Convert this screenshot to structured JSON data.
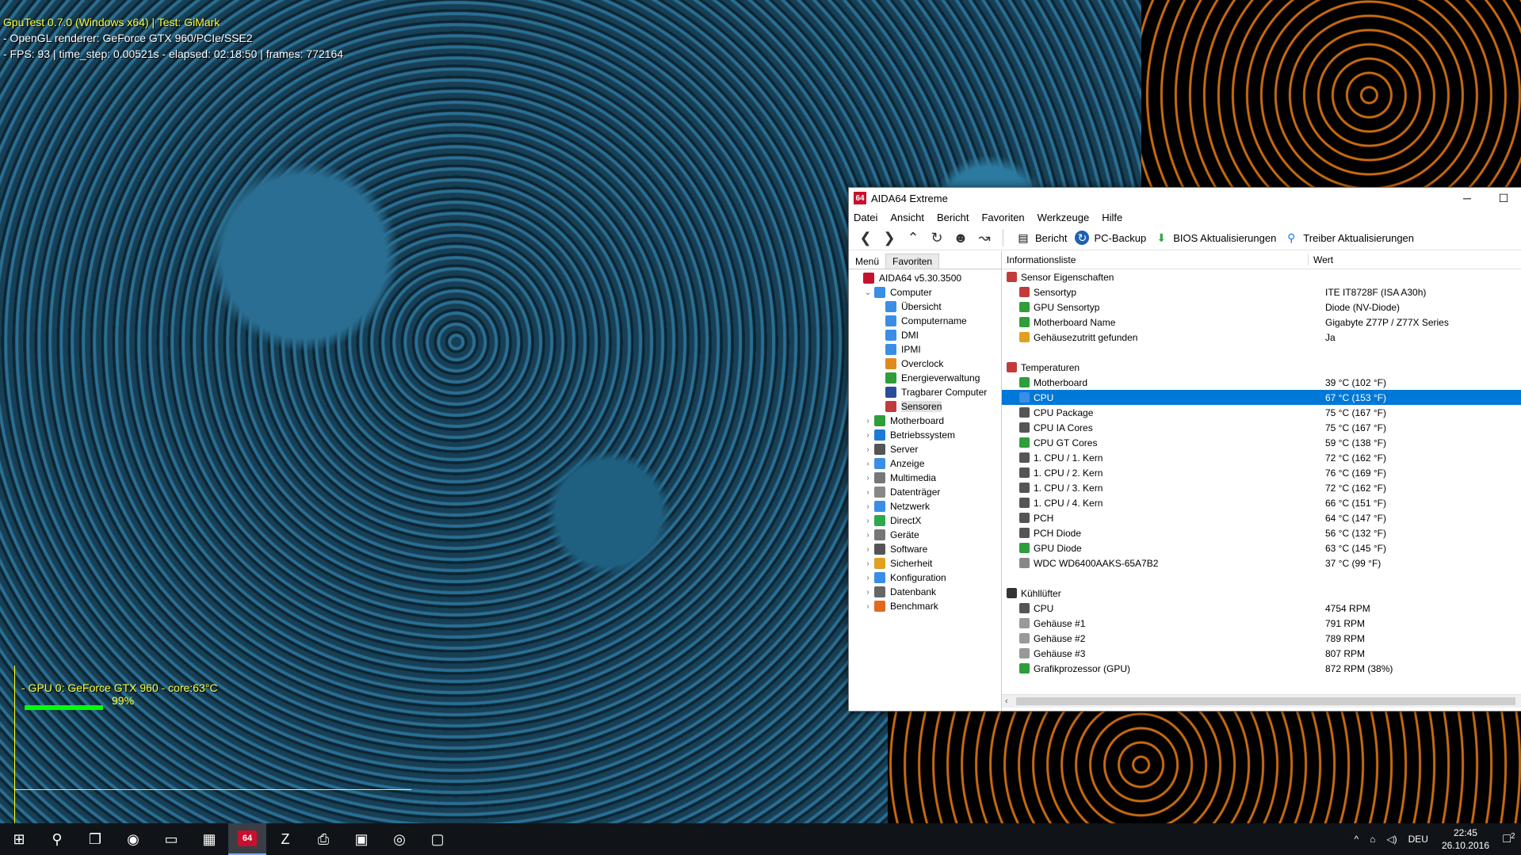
{
  "overlay": {
    "gputest_line1": "GpuTest 0.7.0 (Windows x64) | Test: GiMark",
    "gputest_line2": "- OpenGL renderer: GeForce GTX 960/PCIe/SSE2",
    "gputest_line3": "- FPS: 93 | time_step: 0.00521s - elapsed: 02:18:50 | frames: 772164",
    "gpu_monitor_label": "- GPU 0: GeForce GTX 960 - core:63°C",
    "gpu_monitor_pct": "99%",
    "gpu_utilization": 0.99
  },
  "window": {
    "title": "AIDA64 Extreme",
    "app_icon_text": "64",
    "minimize": "─",
    "maximize": "☐"
  },
  "menu": [
    "Datei",
    "Ansicht",
    "Bericht",
    "Favoriten",
    "Werkzeuge",
    "Hilfe"
  ],
  "toolbar": {
    "bericht": "Bericht",
    "pc_backup": "PC-Backup",
    "bios": "BIOS Aktualisierungen",
    "treiber": "Treiber Aktualisierungen"
  },
  "left_tabs": {
    "menu": "Menü",
    "favoriten": "Favoriten"
  },
  "tree": [
    {
      "label": "AIDA64 v5.30.3500",
      "level": 0,
      "expander": "",
      "color": "#c8102e"
    },
    {
      "label": "Computer",
      "level": 1,
      "expander": "⌄",
      "color": "#3a8ee6"
    },
    {
      "label": "Übersicht",
      "level": 2,
      "expander": "",
      "color": "#3a8ee6"
    },
    {
      "label": "Computername",
      "level": 2,
      "expander": "",
      "color": "#3a8ee6"
    },
    {
      "label": "DMI",
      "level": 2,
      "expander": "",
      "color": "#3a8ee6"
    },
    {
      "label": "IPMI",
      "level": 2,
      "expander": "",
      "color": "#3a8ee6"
    },
    {
      "label": "Overclock",
      "level": 2,
      "expander": "",
      "color": "#e08a1e"
    },
    {
      "label": "Energieverwaltung",
      "level": 2,
      "expander": "",
      "color": "#2e9d3a"
    },
    {
      "label": "Tragbarer Computer",
      "level": 2,
      "expander": "",
      "color": "#2b4c9b"
    },
    {
      "label": "Sensoren",
      "level": 2,
      "expander": "",
      "color": "#c23b3b",
      "selected": true
    },
    {
      "label": "Motherboard",
      "level": 1,
      "expander": "›",
      "color": "#2e9d3a"
    },
    {
      "label": "Betriebssystem",
      "level": 1,
      "expander": "›",
      "color": "#1e7ad6"
    },
    {
      "label": "Server",
      "level": 1,
      "expander": "›",
      "color": "#555"
    },
    {
      "label": "Anzeige",
      "level": 1,
      "expander": "›",
      "color": "#3a8ee6"
    },
    {
      "label": "Multimedia",
      "level": 1,
      "expander": "›",
      "color": "#777"
    },
    {
      "label": "Datenträger",
      "level": 1,
      "expander": "›",
      "color": "#888"
    },
    {
      "label": "Netzwerk",
      "level": 1,
      "expander": "›",
      "color": "#3a8ee6"
    },
    {
      "label": "DirectX",
      "level": 1,
      "expander": "›",
      "color": "#2ea84a"
    },
    {
      "label": "Geräte",
      "level": 1,
      "expander": "›",
      "color": "#777"
    },
    {
      "label": "Software",
      "level": 1,
      "expander": "›",
      "color": "#555"
    },
    {
      "label": "Sicherheit",
      "level": 1,
      "expander": "›",
      "color": "#e0a020"
    },
    {
      "label": "Konfiguration",
      "level": 1,
      "expander": "›",
      "color": "#3a8ee6"
    },
    {
      "label": "Datenbank",
      "level": 1,
      "expander": "›",
      "color": "#666"
    },
    {
      "label": "Benchmark",
      "level": 1,
      "expander": "›",
      "color": "#e06a1e"
    }
  ],
  "list_header": {
    "col1": "Informationsliste",
    "col2": "Wert"
  },
  "list": [
    {
      "type": "sec",
      "name": "Sensor Eigenschaften",
      "value": "",
      "color": "#c23b3b"
    },
    {
      "type": "item",
      "name": "Sensortyp",
      "value": "ITE IT8728F  (ISA A30h)",
      "color": "#c23b3b"
    },
    {
      "type": "item",
      "name": "GPU Sensortyp",
      "value": "Diode  (NV-Diode)",
      "color": "#2e9d3a"
    },
    {
      "type": "item",
      "name": "Motherboard Name",
      "value": "Gigabyte Z77P / Z77X Series",
      "color": "#2e9d3a"
    },
    {
      "type": "item",
      "name": "Gehäusezutritt gefunden",
      "value": "Ja",
      "color": "#e0a020"
    },
    {
      "type": "gap"
    },
    {
      "type": "sec",
      "name": "Temperaturen",
      "value": "",
      "color": "#c23b3b"
    },
    {
      "type": "item",
      "name": "Motherboard",
      "value": "39 °C  (102 °F)",
      "color": "#2e9d3a"
    },
    {
      "type": "item",
      "name": "CPU",
      "value": "67 °C  (153 °F)",
      "color": "#3a8ee6",
      "highlight": true
    },
    {
      "type": "item",
      "name": "CPU Package",
      "value": "75 °C  (167 °F)",
      "color": "#555"
    },
    {
      "type": "item",
      "name": "CPU IA Cores",
      "value": "75 °C  (167 °F)",
      "color": "#555"
    },
    {
      "type": "item",
      "name": "CPU GT Cores",
      "value": "59 °C  (138 °F)",
      "color": "#2e9d3a"
    },
    {
      "type": "item",
      "name": "1. CPU / 1. Kern",
      "value": "72 °C  (162 °F)",
      "color": "#555"
    },
    {
      "type": "item",
      "name": "1. CPU / 2. Kern",
      "value": "76 °C  (169 °F)",
      "color": "#555"
    },
    {
      "type": "item",
      "name": "1. CPU / 3. Kern",
      "value": "72 °C  (162 °F)",
      "color": "#555"
    },
    {
      "type": "item",
      "name": "1. CPU / 4. Kern",
      "value": "66 °C  (151 °F)",
      "color": "#555"
    },
    {
      "type": "item",
      "name": "PCH",
      "value": "64 °C  (147 °F)",
      "color": "#555"
    },
    {
      "type": "item",
      "name": "PCH Diode",
      "value": "56 °C  (132 °F)",
      "color": "#555"
    },
    {
      "type": "item",
      "name": "GPU Diode",
      "value": "63 °C  (145 °F)",
      "color": "#2e9d3a"
    },
    {
      "type": "item",
      "name": "WDC WD6400AAKS-65A7B2",
      "value": "37 °C  (99 °F)",
      "color": "#888"
    },
    {
      "type": "gap"
    },
    {
      "type": "sec",
      "name": "Kühllüfter",
      "value": "",
      "color": "#333"
    },
    {
      "type": "item",
      "name": "CPU",
      "value": "4754 RPM",
      "color": "#555"
    },
    {
      "type": "item",
      "name": "Gehäuse #1",
      "value": "791 RPM",
      "color": "#999"
    },
    {
      "type": "item",
      "name": "Gehäuse #2",
      "value": "789 RPM",
      "color": "#999"
    },
    {
      "type": "item",
      "name": "Gehäuse #3",
      "value": "807 RPM",
      "color": "#999"
    },
    {
      "type": "item",
      "name": "Grafikprozessor (GPU)",
      "value": "872 RPM  (38%)",
      "color": "#2e9d3a"
    }
  ],
  "scroll_left": "‹",
  "taskbar": {
    "apps": [
      {
        "name": "start-button",
        "glyph": "⊞"
      },
      {
        "name": "search-button",
        "glyph": "⚲"
      },
      {
        "name": "task-view-button",
        "glyph": "❐"
      },
      {
        "name": "chrome-app",
        "glyph": "◉"
      },
      {
        "name": "explorer-app",
        "glyph": "▭"
      },
      {
        "name": "gallery-app",
        "glyph": "▦"
      },
      {
        "name": "aida64-app",
        "glyph": "64",
        "active": true
      },
      {
        "name": "gpuz-app",
        "glyph": "Z"
      },
      {
        "name": "printer-app",
        "glyph": "⎙"
      },
      {
        "name": "cpu-app",
        "glyph": "▣"
      },
      {
        "name": "gputest-app",
        "glyph": "◎"
      },
      {
        "name": "window-app",
        "glyph": "▢"
      }
    ],
    "tray_chevron": "^",
    "tray_network": "⌂",
    "tray_volume": "◁)",
    "language": "DEU",
    "time": "22:45",
    "date": "26.10.2016",
    "notifications_count": "2"
  }
}
